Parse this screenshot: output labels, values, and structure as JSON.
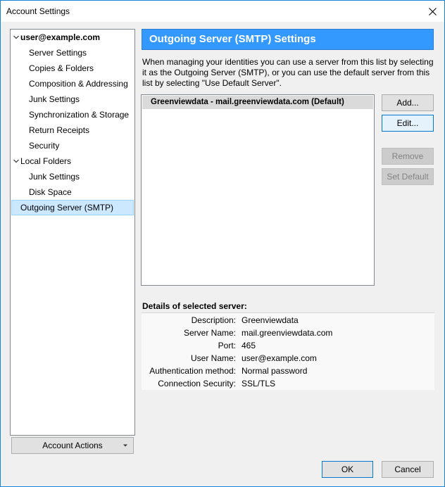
{
  "window": {
    "title": "Account Settings"
  },
  "sidebar": {
    "items": [
      {
        "label": "user@example.com",
        "level": 0,
        "bold": true,
        "expanded": true
      },
      {
        "label": "Server Settings",
        "level": 1
      },
      {
        "label": "Copies & Folders",
        "level": 1
      },
      {
        "label": "Composition & Addressing",
        "level": 1
      },
      {
        "label": "Junk Settings",
        "level": 1
      },
      {
        "label": "Synchronization & Storage",
        "level": 1
      },
      {
        "label": "Return Receipts",
        "level": 1
      },
      {
        "label": "Security",
        "level": 1
      },
      {
        "label": "Local Folders",
        "level": 0,
        "expanded": true
      },
      {
        "label": "Junk Settings",
        "level": 1
      },
      {
        "label": "Disk Space",
        "level": 1
      },
      {
        "label": "Outgoing Server (SMTP)",
        "level": 0,
        "selected": true
      }
    ],
    "account_actions_label": "Account Actions"
  },
  "main": {
    "header": "Outgoing Server (SMTP) Settings",
    "description": "When managing your identities you can use a server from this list by selecting it as the Outgoing Server (SMTP), or you can use the default server from this list by selecting \"Use Default Server\".",
    "servers": [
      "Greenviewdata - mail.greenviewdata.com (Default)"
    ],
    "buttons": {
      "add": "Add...",
      "edit": "Edit...",
      "remove": "Remove",
      "set_default": "Set Default"
    },
    "details_label": "Details of selected server:",
    "details": [
      {
        "key": "Description:",
        "value": "Greenviewdata"
      },
      {
        "key": "Server Name:",
        "value": "mail.greenviewdata.com"
      },
      {
        "key": "Port:",
        "value": "465"
      },
      {
        "key": "User Name:",
        "value": "user@example.com"
      },
      {
        "key": "Authentication method:",
        "value": "Normal password"
      },
      {
        "key": "Connection Security:",
        "value": "SSL/TLS"
      }
    ]
  },
  "footer": {
    "ok": "OK",
    "cancel": "Cancel"
  },
  "colors": {
    "accent": "#3399ff",
    "selection": "#cce8ff",
    "focus_border": "#0078d7"
  }
}
